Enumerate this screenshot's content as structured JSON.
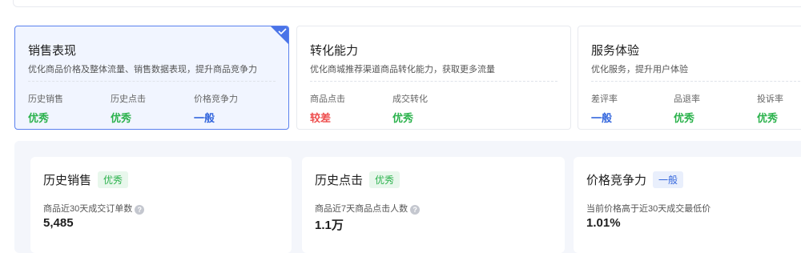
{
  "colors": {
    "good": "#2bb24c",
    "bad": "#ee4d4d",
    "normal": "#3366dd",
    "good_tag_bg": "#e8f7ec",
    "normal_tag_bg": "#e9effc",
    "accent": "#4a74e8"
  },
  "cards": [
    {
      "title": "销售表现",
      "desc": "优化商品价格及整体流量、销售数据表现，提升商品竞争力",
      "selected": true,
      "metrics": [
        {
          "label": "历史销售",
          "value": "优秀",
          "level": "good"
        },
        {
          "label": "历史点击",
          "value": "优秀",
          "level": "good"
        },
        {
          "label": "价格竞争力",
          "value": "一般",
          "level": "normal"
        }
      ]
    },
    {
      "title": "转化能力",
      "desc": "优化商城推荐渠道商品转化能力，获取更多流量",
      "selected": false,
      "metrics": [
        {
          "label": "商品点击",
          "value": "较差",
          "level": "bad"
        },
        {
          "label": "成交转化",
          "value": "优秀",
          "level": "good"
        }
      ]
    },
    {
      "title": "服务体验",
      "desc": "优化服务，提升用户体验",
      "selected": false,
      "metrics": [
        {
          "label": "差评率",
          "value": "一般",
          "level": "normal"
        },
        {
          "label": "品退率",
          "value": "优秀",
          "level": "good"
        },
        {
          "label": "投诉率",
          "value": "优秀",
          "level": "good"
        }
      ]
    }
  ],
  "details": [
    {
      "title": "历史销售",
      "tag": "优秀",
      "level": "good",
      "sub": "商品近30天成交订单数",
      "help_icon": true,
      "value": "5,485"
    },
    {
      "title": "历史点击",
      "tag": "优秀",
      "level": "good",
      "sub": "商品近7天商品点击人数",
      "help_icon": true,
      "value": "1.1万"
    },
    {
      "title": "价格竞争力",
      "tag": "一般",
      "level": "normal",
      "sub": "当前价格高于近30天成交最低价",
      "help_icon": false,
      "value": "1.01%"
    }
  ],
  "icons": {
    "selected_corner": "check-icon",
    "help": "question-circle-icon"
  }
}
